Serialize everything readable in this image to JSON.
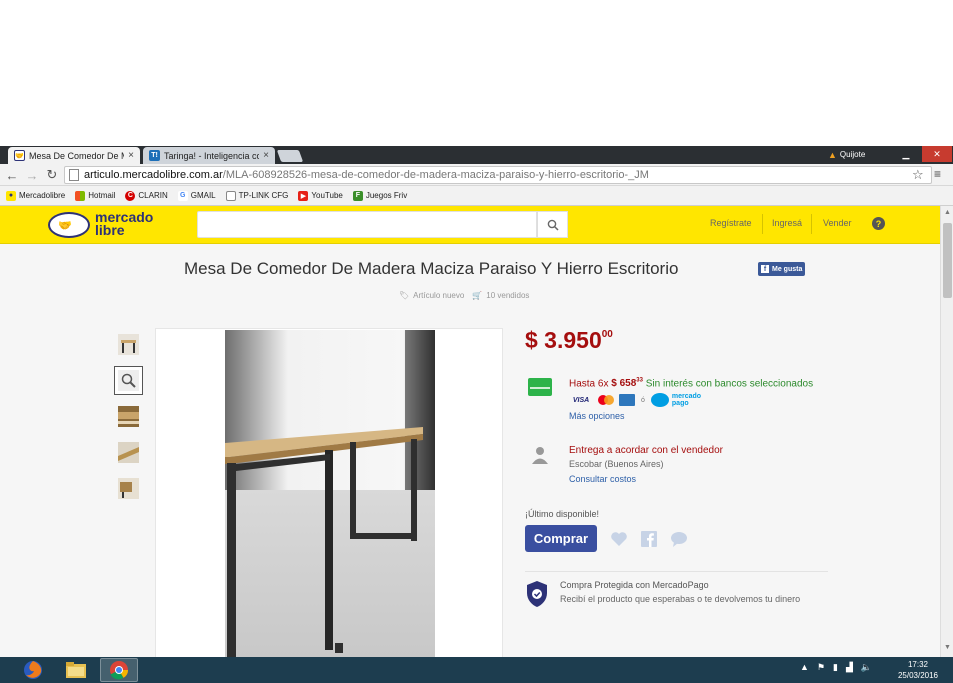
{
  "browser": {
    "tabs": [
      {
        "title": "Mesa De Comedor De Ma",
        "close": "×"
      },
      {
        "title": "Taringa! - Inteligencia co",
        "close": "×"
      }
    ],
    "user_label": "Quijote",
    "address": {
      "host": "articulo.mercadolibre.com.ar",
      "path": "/MLA-608928526-mesa-de-comedor-de-madera-maciza-paraiso-y-hierro-escritorio-_JM"
    },
    "bookmarks": [
      {
        "label": "Mercadolibre",
        "icon": "handshake-icon",
        "color": "#2d3277"
      },
      {
        "label": "Hotmail",
        "icon": "windows-icon",
        "color": "#f25022"
      },
      {
        "label": "CLARIN",
        "icon": "clarin-icon",
        "color": "#d40000"
      },
      {
        "label": "GMAIL",
        "icon": "google-icon",
        "color": "#4285f4"
      },
      {
        "label": "TP-LINK CFG",
        "icon": "page-icon",
        "color": "#888888"
      },
      {
        "label": "YouTube",
        "icon": "youtube-icon",
        "color": "#e62117"
      },
      {
        "label": "Juegos Friv",
        "icon": "friv-icon",
        "color": "#3b8f2a"
      }
    ]
  },
  "site": {
    "logo_line1": "mercado",
    "logo_line2": "libre",
    "search_placeholder": "",
    "links": {
      "register": "Regístrate",
      "login": "Ingresá",
      "sell": "Vender"
    },
    "brand_color": "#ffe600"
  },
  "product": {
    "title": "Mesa De Comedor De Madera Maciza Paraiso Y Hierro Escritorio",
    "fb_like": "Me gusta",
    "condition": "Artículo nuevo",
    "sold": "10 vendidos",
    "price_main": "$ 3.950",
    "price_cents": "00",
    "installments_prefix": "Hasta 6x",
    "installment_amount": "$ 658",
    "installment_cents": "33",
    "installments_suffix": "Sin interés con bancos seleccionados",
    "card_or": "ó",
    "cards": [
      "VISA",
      "mastercard",
      "amex"
    ],
    "mercadopago_line1": "mercado",
    "mercadopago_line2": "pago",
    "more_options": "Más opciones",
    "shipping_title": "Entrega a acordar con el vendedor",
    "shipping_location": "Escobar (Buenos Aires)",
    "shipping_costs": "Consultar costos",
    "stock_note": "¡Último disponible!",
    "buy_label": "Comprar",
    "protection_title": "Compra Protegida con MercadoPago",
    "protection_desc": "Recibí el producto que esperabas o te devolvemos tu dinero",
    "price_color": "#a50e0e",
    "button_color": "#3a4fa0"
  },
  "taskbar": {
    "time": "17:32",
    "date": "25/03/2016"
  }
}
